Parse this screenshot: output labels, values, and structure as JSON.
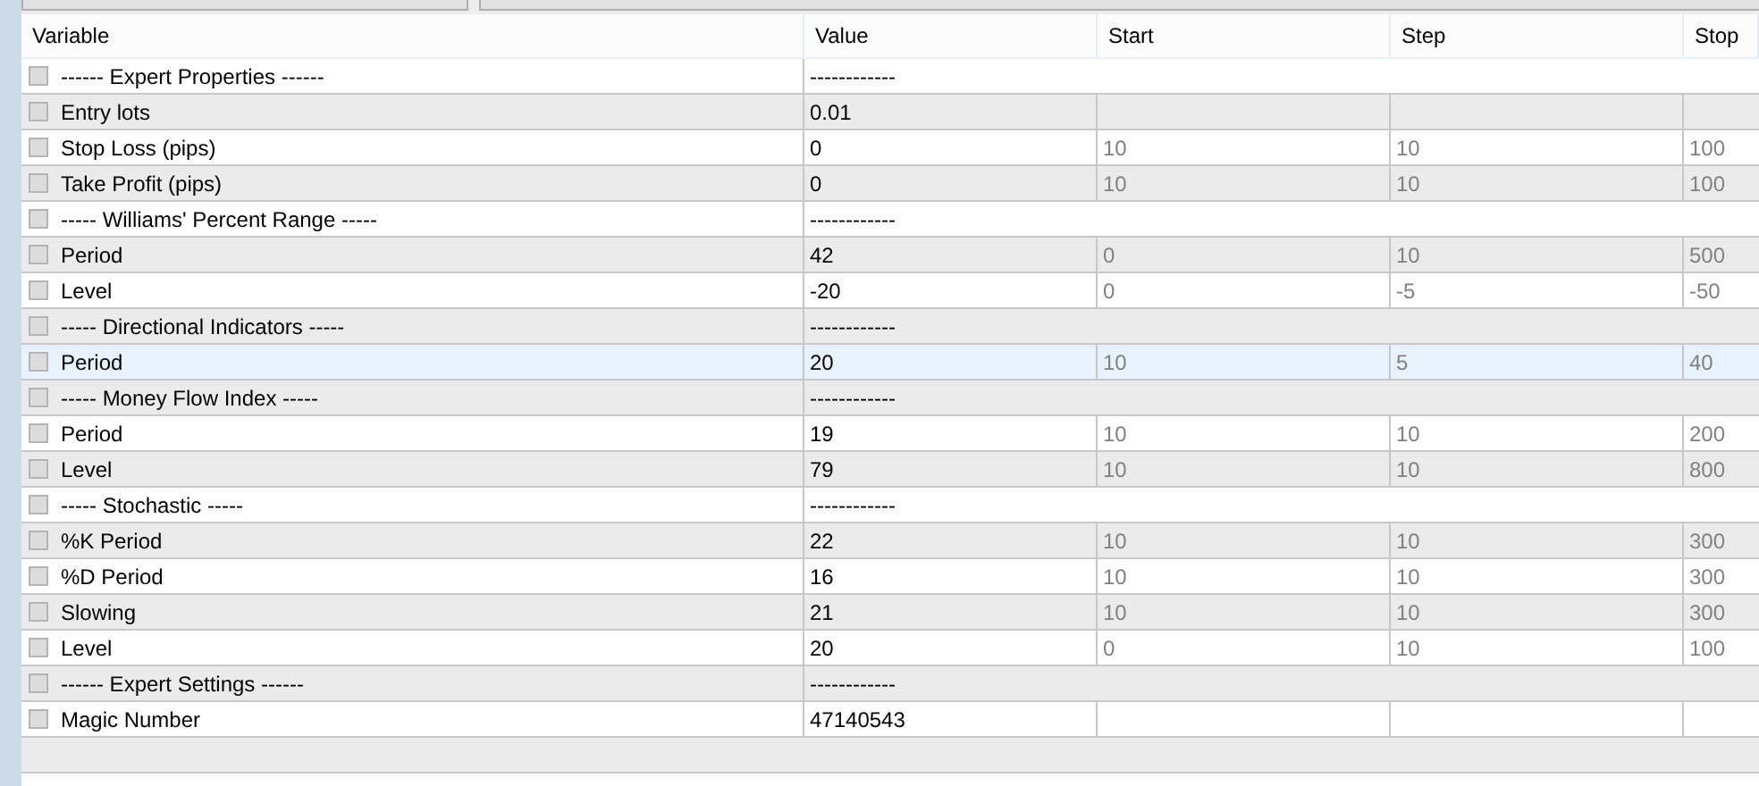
{
  "table": {
    "columns": [
      "Variable",
      "Value",
      "Start",
      "Step",
      "Stop"
    ],
    "rows": [
      {
        "kind": "separator",
        "name": "------ Expert Properties ------",
        "value": "------------",
        "checked": false,
        "selected": false
      },
      {
        "kind": "param",
        "name": "Entry lots",
        "value": "0.01",
        "checked": false,
        "selected": false
      },
      {
        "kind": "param",
        "name": "Stop Loss (pips)",
        "value": "0",
        "start": "10",
        "step": "10",
        "stop": "100",
        "checked": false,
        "selected": false
      },
      {
        "kind": "param",
        "name": "Take Profit (pips)",
        "value": "0",
        "start": "10",
        "step": "10",
        "stop": "100",
        "checked": false,
        "selected": false
      },
      {
        "kind": "separator",
        "name": "----- Williams' Percent Range -----",
        "value": "------------",
        "checked": false,
        "selected": false
      },
      {
        "kind": "param",
        "name": "Period",
        "value": "42",
        "start": "0",
        "step": "10",
        "stop": "500",
        "checked": false,
        "selected": false
      },
      {
        "kind": "param",
        "name": "Level",
        "value": "-20",
        "start": "0",
        "step": "-5",
        "stop": "-50",
        "checked": false,
        "selected": false
      },
      {
        "kind": "separator",
        "name": "----- Directional Indicators -----",
        "value": "------------",
        "checked": false,
        "selected": false
      },
      {
        "kind": "param",
        "name": "Period",
        "value": "20",
        "start": "10",
        "step": "5",
        "stop": "40",
        "checked": false,
        "selected": true
      },
      {
        "kind": "separator",
        "name": "----- Money Flow Index -----",
        "value": "------------",
        "checked": false,
        "selected": false
      },
      {
        "kind": "param",
        "name": "Period",
        "value": "19",
        "start": "10",
        "step": "10",
        "stop": "200",
        "checked": false,
        "selected": false
      },
      {
        "kind": "param",
        "name": "Level",
        "value": "79",
        "start": "10",
        "step": "10",
        "stop": "800",
        "checked": false,
        "selected": false
      },
      {
        "kind": "separator",
        "name": "----- Stochastic -----",
        "value": "------------",
        "checked": false,
        "selected": false
      },
      {
        "kind": "param",
        "name": "%K Period",
        "value": "22",
        "start": "10",
        "step": "10",
        "stop": "300",
        "checked": false,
        "selected": false
      },
      {
        "kind": "param",
        "name": "%D Period",
        "value": "16",
        "start": "10",
        "step": "10",
        "stop": "300",
        "checked": false,
        "selected": false
      },
      {
        "kind": "param",
        "name": "Slowing",
        "value": "21",
        "start": "10",
        "step": "10",
        "stop": "300",
        "checked": false,
        "selected": false
      },
      {
        "kind": "param",
        "name": "Level",
        "value": "20",
        "start": "0",
        "step": "10",
        "stop": "100",
        "checked": false,
        "selected": false
      },
      {
        "kind": "separator",
        "name": "------ Expert Settings ------",
        "value": "------------",
        "checked": false,
        "selected": false
      },
      {
        "kind": "param",
        "name": "Magic Number",
        "value": "47140543",
        "checked": false,
        "selected": false
      }
    ]
  }
}
